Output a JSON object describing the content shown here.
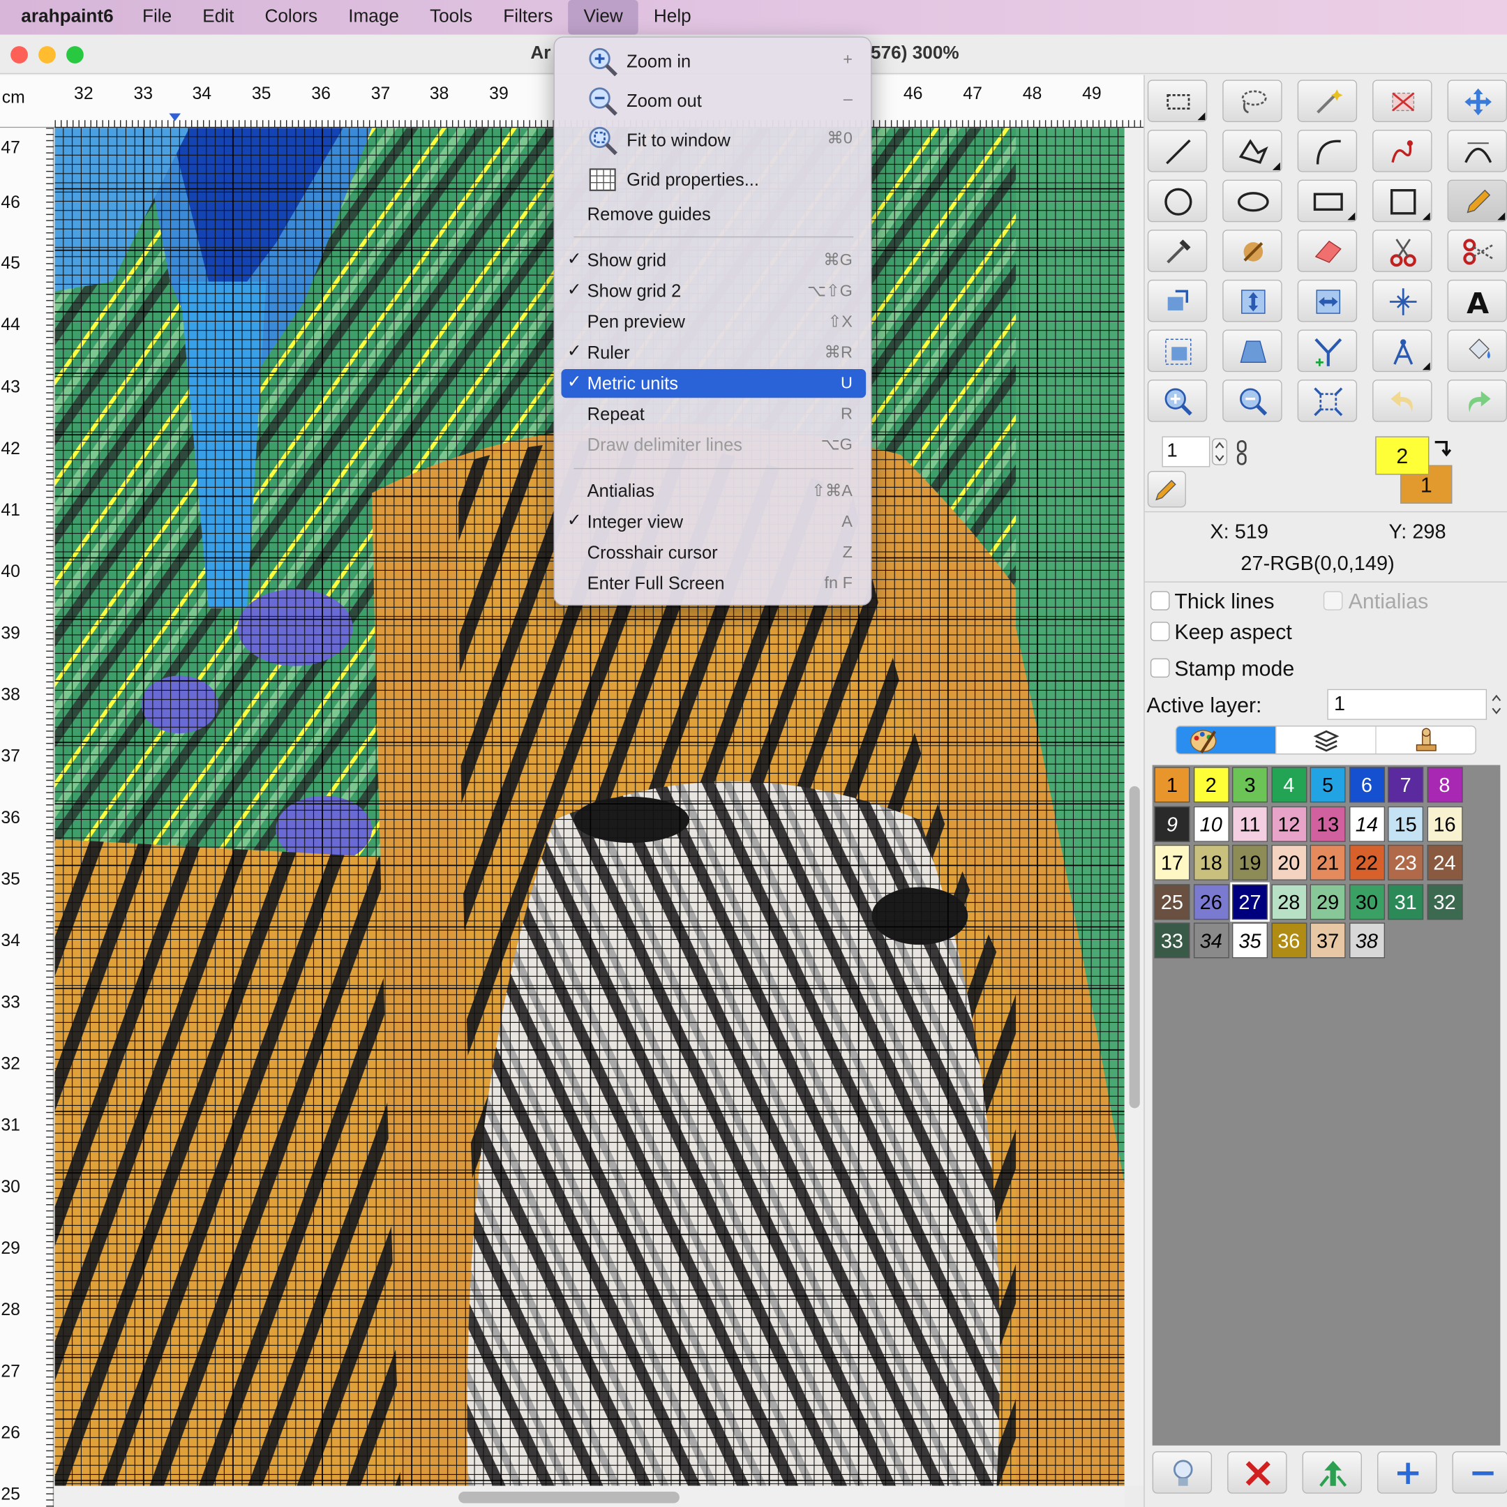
{
  "menubar": {
    "app": "arahpaint6",
    "items": [
      "File",
      "Edit",
      "Colors",
      "Image",
      "Tools",
      "Filters",
      "View",
      "Help"
    ]
  },
  "window": {
    "title_left": "Ar",
    "title_right": "576) 300%"
  },
  "ruler": {
    "unit": "cm",
    "h_labels": [
      "32",
      "33",
      "34",
      "35",
      "36",
      "37",
      "38",
      "39",
      "46",
      "47",
      "48",
      "49"
    ],
    "v_labels": [
      "47",
      "46",
      "45",
      "44",
      "43",
      "42",
      "41",
      "40",
      "39",
      "38",
      "37",
      "36",
      "35",
      "34",
      "33",
      "32",
      "31",
      "30",
      "29",
      "28",
      "27",
      "26",
      "25"
    ]
  },
  "view_menu": {
    "zoom_in": "Zoom in",
    "zoom_in_sc": "+",
    "zoom_out": "Zoom out",
    "zoom_out_sc": "–",
    "fit": "Fit to window",
    "fit_sc": "⌘0",
    "grid_props": "Grid properties...",
    "remove_guides": "Remove guides",
    "show_grid": "Show grid",
    "show_grid_sc": "⌘G",
    "show_grid2": "Show grid 2",
    "show_grid2_sc": "⌥⇧G",
    "pen_preview": "Pen preview",
    "pen_preview_sc": "⇧X",
    "ruler": "Ruler",
    "ruler_sc": "⌘R",
    "metric": "Metric units",
    "metric_sc": "U",
    "repeat": "Repeat",
    "repeat_sc": "R",
    "delim": "Draw delimiter lines",
    "delim_sc": "⌥G",
    "antialias": "Antialias",
    "antialias_sc": "⇧⌘A",
    "integer": "Integer view",
    "integer_sc": "A",
    "crosshair": "Crosshair cursor",
    "crosshair_sc": "Z",
    "fullscreen": "Enter Full Screen",
    "fullscreen_sc": "fn F",
    "check": "✓"
  },
  "panel": {
    "pen_size": "1",
    "fg_index": "2",
    "bg_index": "1",
    "x_label": "X: 519",
    "y_label": "Y: 298",
    "color_info": "27-RGB(0,0,149)",
    "thick_lines": "Thick lines",
    "antialias": "Antialias",
    "keep_aspect": "Keep aspect",
    "stamp_mode": "Stamp mode",
    "active_layer_label": "Active layer:",
    "active_layer_value": "1"
  },
  "palette": [
    {
      "n": "1",
      "c": "#e8962c",
      "t": "#000"
    },
    {
      "n": "2",
      "c": "#ffff38",
      "t": "#000"
    },
    {
      "n": "3",
      "c": "#6cc356",
      "t": "#000"
    },
    {
      "n": "4",
      "c": "#23a455",
      "t": "#fff"
    },
    {
      "n": "5",
      "c": "#22a4e4",
      "t": "#000"
    },
    {
      "n": "6",
      "c": "#1450d0",
      "t": "#fff"
    },
    {
      "n": "7",
      "c": "#5a2a9e",
      "t": "#fff"
    },
    {
      "n": "8",
      "c": "#a828b4",
      "t": "#fff"
    },
    {
      "n": "9",
      "c": "#2a2a2a",
      "t": "#fff"
    },
    {
      "n": "10",
      "c": "#ffffff",
      "t": "#000"
    },
    {
      "n": "11",
      "c": "#f4cfe2",
      "t": "#000"
    },
    {
      "n": "12",
      "c": "#e8a4c8",
      "t": "#000"
    },
    {
      "n": "13",
      "c": "#d0609e",
      "t": "#000"
    },
    {
      "n": "14",
      "c": "#ffffff",
      "t": "#000"
    },
    {
      "n": "15",
      "c": "#c4e2f4",
      "t": "#000"
    },
    {
      "n": "16",
      "c": "#f8f2d0",
      "t": "#000"
    },
    {
      "n": "17",
      "c": "#fff8c4",
      "t": "#000"
    },
    {
      "n": "18",
      "c": "#c8c07c",
      "t": "#000"
    },
    {
      "n": "19",
      "c": "#8e8c56",
      "t": "#000"
    },
    {
      "n": "20",
      "c": "#f4d4c0",
      "t": "#000"
    },
    {
      "n": "21",
      "c": "#e48a5c",
      "t": "#000"
    },
    {
      "n": "22",
      "c": "#d8602a",
      "t": "#000"
    },
    {
      "n": "23",
      "c": "#b06a4a",
      "t": "#fff"
    },
    {
      "n": "24",
      "c": "#8a5a40",
      "t": "#fff"
    },
    {
      "n": "25",
      "c": "#6a5040",
      "t": "#fff"
    },
    {
      "n": "26",
      "c": "#7a7ad0",
      "t": "#000"
    },
    {
      "n": "27",
      "c": "#00007e",
      "t": "#fff"
    },
    {
      "n": "28",
      "c": "#b8e0c4",
      "t": "#000"
    },
    {
      "n": "29",
      "c": "#88c898",
      "t": "#000"
    },
    {
      "n": "30",
      "c": "#3aa064",
      "t": "#000"
    },
    {
      "n": "31",
      "c": "#2c8a58",
      "t": "#fff"
    },
    {
      "n": "32",
      "c": "#3c6a50",
      "t": "#fff"
    },
    {
      "n": "33",
      "c": "#3a5a48",
      "t": "#fff"
    },
    {
      "n": "34",
      "c": "#8a8a8a",
      "t": "#000"
    },
    {
      "n": "35",
      "c": "#ffffff",
      "t": "#000"
    },
    {
      "n": "36",
      "c": "#b08c14",
      "t": "#fff"
    },
    {
      "n": "37",
      "c": "#e8c8a4",
      "t": "#000"
    },
    {
      "n": "38",
      "c": "#d8d8d8",
      "t": "#000"
    }
  ],
  "colors": {
    "menu_highlight": "#2a62d8",
    "close": "#fe5f57",
    "minimize": "#febc2e",
    "zoom": "#28c840"
  }
}
